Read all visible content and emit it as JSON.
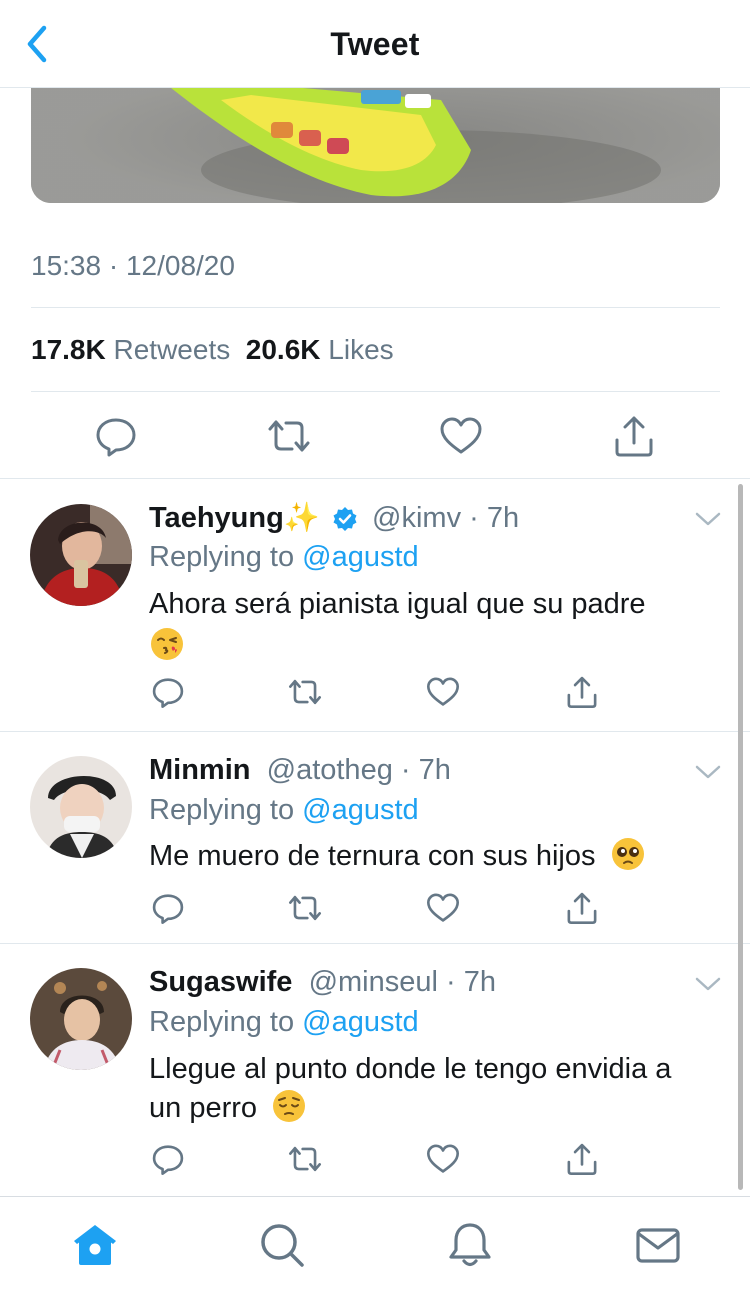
{
  "header": {
    "title": "Tweet"
  },
  "tweet": {
    "timestamp": "15:38 · 12/08/20",
    "retweets_count": "17.8K",
    "retweets_label": "Retweets",
    "likes_count": "20.6K",
    "likes_label": "Likes"
  },
  "replies": [
    {
      "name": "Taehyung✨",
      "handle": "@kimv",
      "time": "· 7h",
      "verified": true,
      "replying_prefix": "Replying to ",
      "replying_to": "@agustd",
      "text": "Ahora será pianista igual que su padre",
      "emoji": "face-blowing-kiss"
    },
    {
      "name": "Minmin",
      "handle": "@atotheg",
      "time": "· 7h",
      "verified": false,
      "replying_prefix": "Replying to ",
      "replying_to": "@agustd",
      "text": "Me muero de ternura con sus hijos",
      "emoji": "pleading-face"
    },
    {
      "name": "Sugaswife",
      "handle": "@minseul",
      "time": "· 7h",
      "verified": false,
      "replying_prefix": "Replying to ",
      "replying_to": "@agustd",
      "text": "Llegue al punto donde le tengo envidia a un perro",
      "emoji": "pensive-face"
    }
  ],
  "tabbar": {
    "items": [
      "home-icon",
      "search-icon",
      "notifications-icon",
      "messages-icon"
    ],
    "active": "home-icon"
  },
  "colors": {
    "accent": "#1da1f2",
    "secondary_text": "#657786",
    "primary_text": "#14171a",
    "divider": "#e1e8ed"
  }
}
